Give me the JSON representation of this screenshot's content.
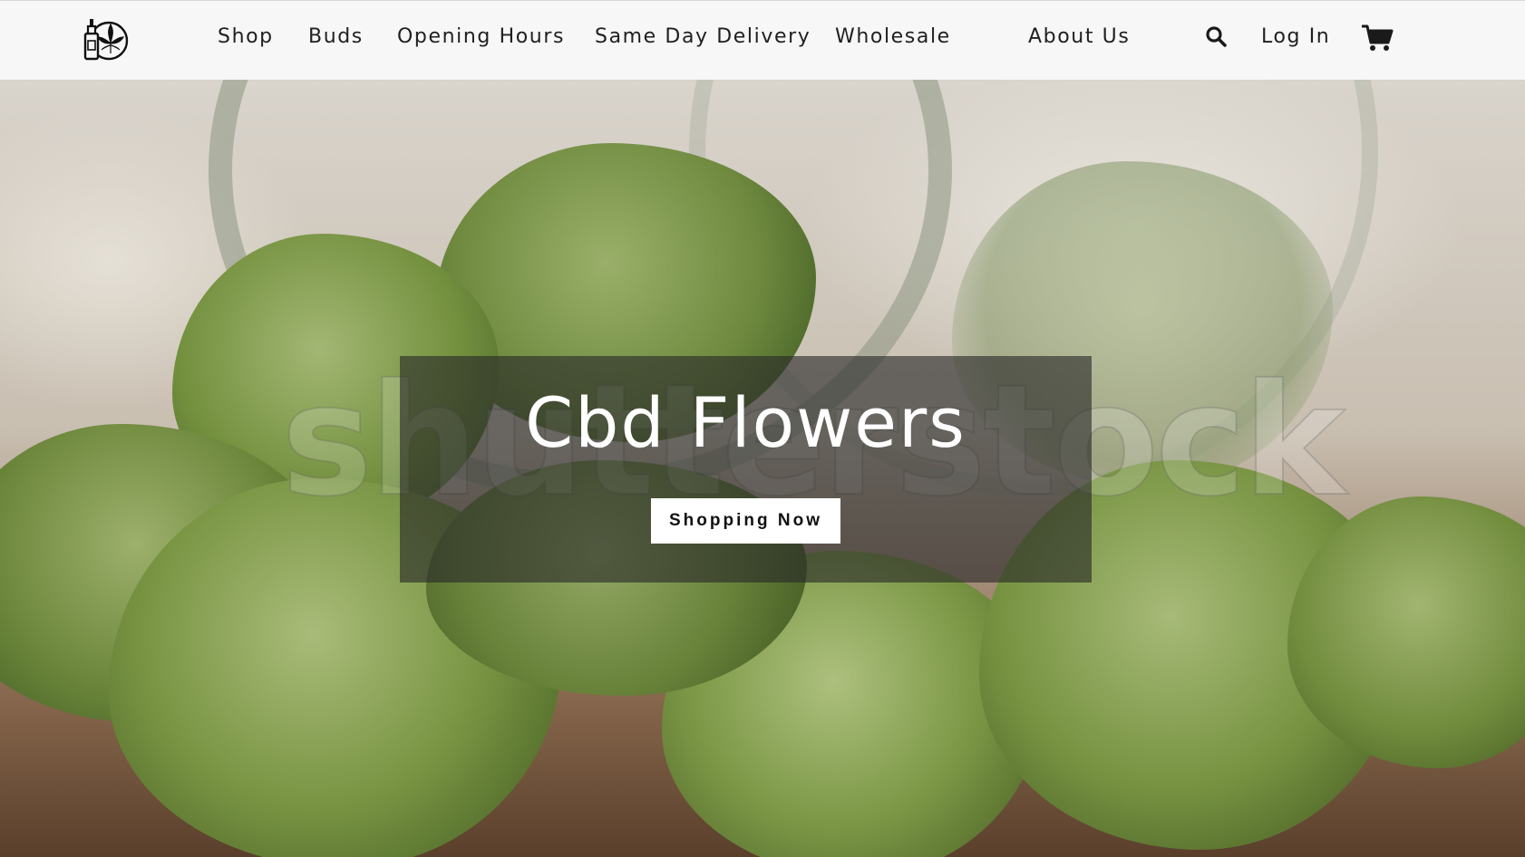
{
  "header": {
    "logo_icon": "cbd-oil-bottle-leaf-icon",
    "nav": [
      {
        "label": "Shop"
      },
      {
        "label": "Buds"
      },
      {
        "label": "Opening Hours"
      },
      {
        "label": "Same Day Delivery"
      },
      {
        "label": "Wholesale"
      },
      {
        "label": "About Us"
      }
    ],
    "search_icon": "search-icon",
    "login_label": "Log In",
    "cart_icon": "cart-icon"
  },
  "hero": {
    "title": "Cbd Flowers",
    "button_label": "Shopping Now",
    "watermark": "shutterstock"
  },
  "colors": {
    "header_bg": "#f7f7f7",
    "overlay": "#282828",
    "button_bg": "#ffffff",
    "text_dark": "#1f1f1f"
  }
}
